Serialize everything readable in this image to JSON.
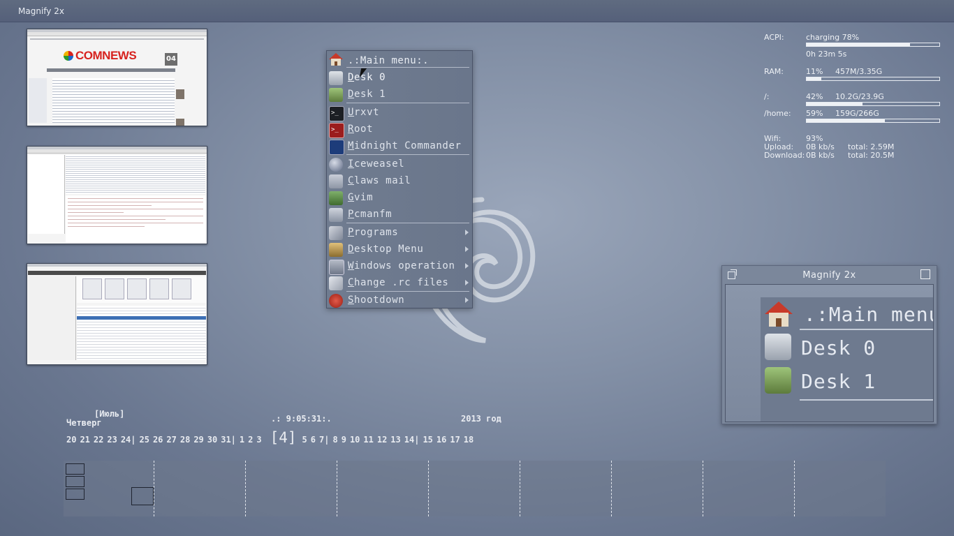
{
  "topbar": {
    "title": "Magnify 2x"
  },
  "thumbnails": [
    {
      "name": "comnews",
      "logo": "COMNEWS",
      "date_day": "04"
    },
    {
      "name": "file-manager"
    },
    {
      "name": "music-player"
    }
  ],
  "menu": {
    "title": ".:Main menu:.",
    "items": [
      {
        "label": "Desk 0",
        "icon": "paint-bucket-icon",
        "submenu": false
      },
      {
        "label": "Desk 1",
        "icon": "paint-can-icon",
        "submenu": false
      },
      {
        "label": "Urxvt",
        "icon": "terminal-icon",
        "submenu": false
      },
      {
        "label": "Root",
        "icon": "root-terminal-icon",
        "submenu": false
      },
      {
        "label": "Midnight Commander",
        "icon": "mc-icon",
        "submenu": false
      },
      {
        "label": "Iceweasel",
        "icon": "globe-icon",
        "submenu": false
      },
      {
        "label": "Claws mail",
        "icon": "mail-icon",
        "submenu": false
      },
      {
        "label": "Gvim",
        "icon": "vim-icon",
        "submenu": false
      },
      {
        "label": "Pcmanfm",
        "icon": "file-manager-icon",
        "submenu": false
      },
      {
        "label": "Programs",
        "icon": "tools-icon",
        "submenu": true
      },
      {
        "label": "Desktop Menu",
        "icon": "desktop-icon",
        "submenu": true
      },
      {
        "label": "Windows operation",
        "icon": "window-icon",
        "submenu": true
      },
      {
        "label": "Change .rc files",
        "icon": "edit-icon",
        "submenu": true
      },
      {
        "label": "Shootdown",
        "icon": "power-icon",
        "submenu": true
      }
    ]
  },
  "conky": {
    "acpi_label": "ACPI:",
    "acpi_value": "charging 78%",
    "acpi_time": "0h 23m 5s",
    "acpi_level": 0.78,
    "ram_label": "RAM:",
    "ram_pct": "11%",
    "ram_used": "457M/3.35G",
    "ram_level": 0.11,
    "root_label": "/:",
    "root_pct": "42%",
    "root_used": "10.2G/23.9G",
    "root_level": 0.42,
    "home_label": "/home:",
    "home_pct": "59%",
    "home_used": "159G/266G",
    "home_level": 0.59,
    "wifi_label": "Wifi:",
    "wifi_value": "93%",
    "upload_label": "Upload:",
    "upload_speed": "0B kb/s",
    "upload_total": "total: 2.59M",
    "download_label": "Download:",
    "download_speed": "0B kb/s",
    "download_total": "total: 20.5M"
  },
  "magnifier": {
    "title": "Magnify 2x",
    "zoom_title": ".:Main menu",
    "zoom_item1": "Desk 0",
    "zoom_item2": "Desk 1"
  },
  "calendar": {
    "month": "[Июль]",
    "weekday": "Четверг",
    "time": ".: 9:05:31:.",
    "year": "2013 год",
    "days_before": [
      "20",
      "21",
      "22",
      "23",
      "24|",
      "25",
      "26",
      "27",
      "28",
      "29",
      "30",
      "31|",
      "1",
      "2",
      "3"
    ],
    "today": "[4]",
    "days_after": [
      "5",
      "6",
      "7|",
      "8",
      "9",
      "10",
      "11",
      "12",
      "13",
      "14|",
      "15",
      "16",
      "17",
      "18"
    ]
  },
  "colors": {
    "accent": "#e9edf3",
    "menu_bg": "#6e7a8e",
    "desktop": "#8390a6"
  }
}
